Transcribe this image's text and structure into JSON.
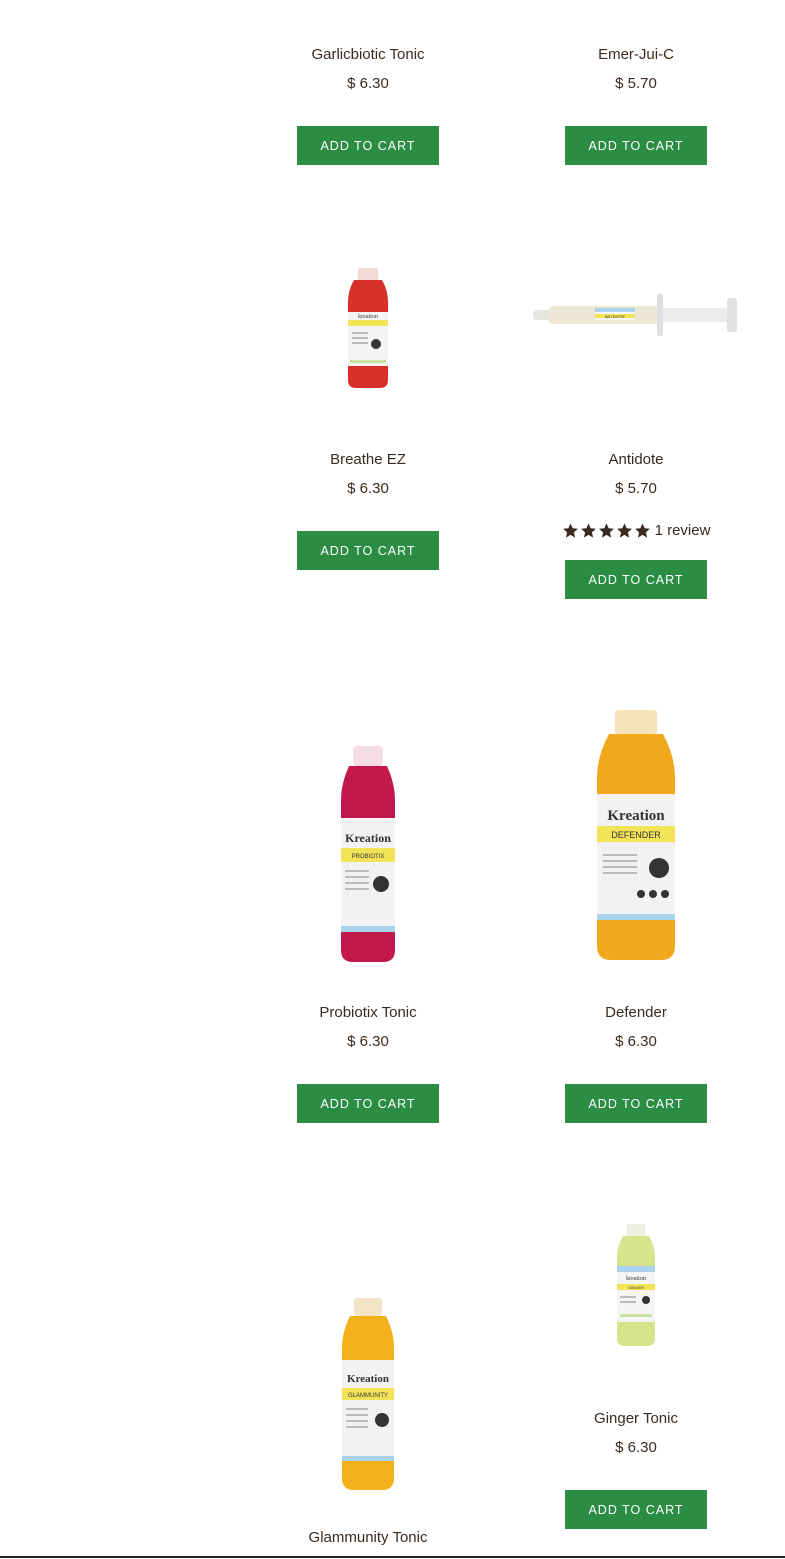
{
  "products": [
    {
      "name": "Garlicbiotic Tonic",
      "price": "$ 6.30",
      "button": "ADD TO CART",
      "color": "#2b8d43"
    },
    {
      "name": "Emer-Jui-C",
      "price": "$ 5.70",
      "button": "ADD TO CART"
    },
    {
      "name": "Breathe EZ",
      "price": "$ 6.30",
      "button": "ADD TO CART",
      "image_label": "kreation"
    },
    {
      "name": "Antidote",
      "price": "$ 5.70",
      "button": "ADD TO CART",
      "rating": 5,
      "review_text": "1 review",
      "image_label": "ANTIDOTE"
    },
    {
      "name": "Probiotix Tonic",
      "price": "$ 6.30",
      "button": "ADD TO CART",
      "image_label": "Kreation",
      "image_sublabel": "PROBIOTIX"
    },
    {
      "name": "Defender",
      "price": "$ 6.30",
      "button": "ADD TO CART",
      "image_label": "Kreation",
      "image_sublabel": "DEFENDER"
    },
    {
      "name": "Glammunity Tonic",
      "image_label": "Kreation",
      "image_sublabel": "GLAMMUNITY"
    },
    {
      "name": "Ginger Tonic",
      "price": "$ 6.30",
      "button": "ADD TO CART",
      "image_label": "kreation",
      "image_sublabel": "GINGER"
    }
  ]
}
